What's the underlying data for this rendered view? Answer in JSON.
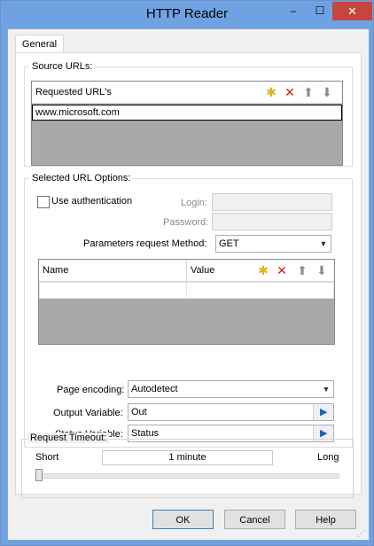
{
  "window": {
    "title": "HTTP Reader",
    "min": "–",
    "max": "☐",
    "close": "✕"
  },
  "tabs": [
    {
      "label": "General"
    }
  ],
  "source": {
    "legend": "Source URLs:",
    "header": "Requested URL's",
    "rows": [
      "www.microsoft.com"
    ]
  },
  "options": {
    "legend": "Selected URL Options:",
    "use_auth": "Use authentication",
    "login_label": "Login:",
    "password_label": "Password:",
    "method_label": "Parameters request Method:",
    "method_value": "GET",
    "columns": [
      "Name",
      "Value"
    ],
    "page_encoding_label": "Page encoding:",
    "page_encoding_value": "Autodetect",
    "output_label": "Output Variable:",
    "output_value": "Out",
    "status_label": "Status Variable:",
    "status_value": "Status"
  },
  "timeout": {
    "legend": "Request Timeout:",
    "short": "Short",
    "value": "1 minute",
    "long": "Long",
    "slider_level": 0
  },
  "buttons": {
    "ok": "OK",
    "cancel": "Cancel",
    "help": "Help"
  },
  "colors": {
    "delete_icon": "#d81e05",
    "arrow_icon": "#8c8c8c",
    "add_icon": "#f3c623",
    "title_bar": "#6fa2e3"
  }
}
